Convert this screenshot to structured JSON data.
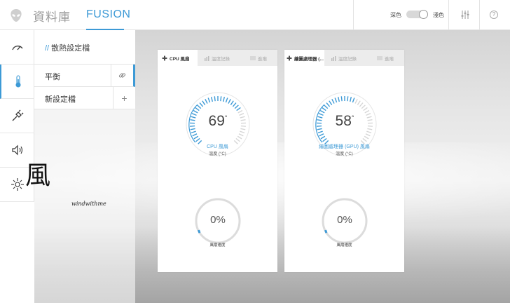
{
  "header": {
    "tab_library": "資料庫",
    "tab_fusion": "FUSION",
    "theme_dark": "深色",
    "theme_light": "淺色",
    "icons": [
      "alien-logo-icon",
      "equalizer-icon",
      "help-icon"
    ]
  },
  "rail": {
    "items": [
      "gauge-icon",
      "thermometer-icon",
      "power-plug-icon",
      "speaker-icon",
      "brightness-icon"
    ],
    "active_index": 1
  },
  "profiles": {
    "title": "散熱設定檔",
    "title_prefix": "//",
    "items": [
      {
        "name": "平衡",
        "action_icon": "link-icon",
        "action": "🔗"
      },
      {
        "name": "新設定檔",
        "action_icon": "plus-icon",
        "action": "+"
      }
    ]
  },
  "watermark": {
    "glyph": "風",
    "text": "windwithme"
  },
  "cards": [
    {
      "tabs": [
        "CPU 風扇",
        "溫度記錄",
        "進階"
      ],
      "temperature": "69",
      "degree": "°",
      "temperature_fraction": 0.69,
      "fan_label": "CPU 風扇",
      "temp_label": "溫度 (°C)",
      "fan_speed": "0%",
      "fan_speed_fraction": 0.0,
      "speed_label": "風扇速度"
    },
    {
      "tabs": [
        "繪圖處理器 (...",
        "溫度記錄",
        "進階"
      ],
      "temperature": "58",
      "degree": "°",
      "temperature_fraction": 0.58,
      "fan_label": "繪圖處理器 (GPU) 風扇",
      "temp_label": "溫度 (°C)",
      "fan_speed": "0%",
      "fan_speed_fraction": 0.0,
      "speed_label": "風扇速度"
    }
  ],
  "colors": {
    "accent": "#3d9ad6",
    "gauge_track": "#d6d6d6"
  }
}
